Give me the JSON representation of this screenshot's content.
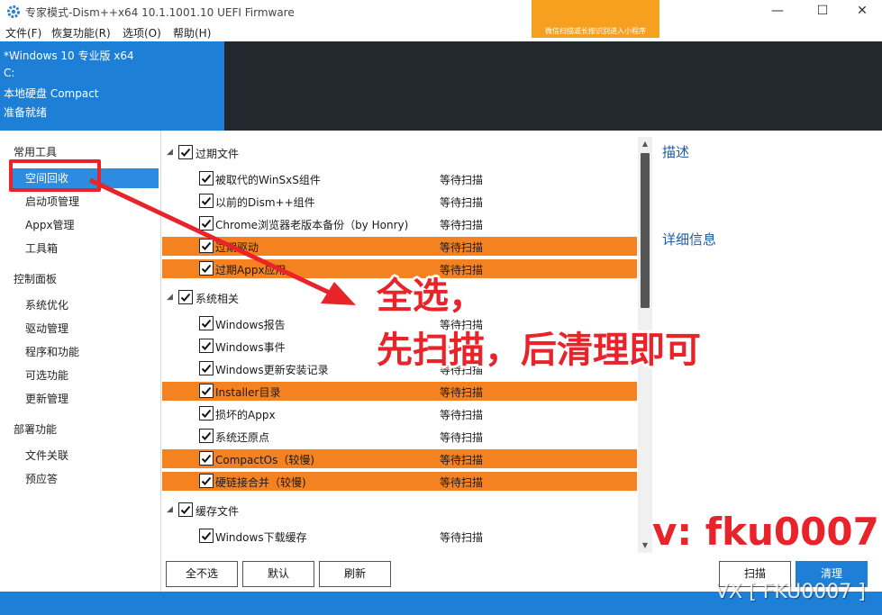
{
  "titlebar": {
    "title": "专家模式-Dism++x64 10.1.1001.10 UEFI Firmware",
    "min_glyph": "—",
    "max_glyph": "☐",
    "close_glyph": "✕"
  },
  "banner_ad": {
    "text": "微信扫描或长按识别进入小程序"
  },
  "menu": [
    {
      "label": "文件(F)"
    },
    {
      "label": "恢复功能(R)"
    },
    {
      "label": "选项(O)"
    },
    {
      "label": "帮助(H)"
    }
  ],
  "info": {
    "os": "*Windows 10 专业版 x64",
    "drive": "C:",
    "disk": "本地硬盘 Compact",
    "status": "准备就绪"
  },
  "sidebar": {
    "groups": [
      {
        "label": "常用工具",
        "items": [
          "空间回收",
          "启动项管理",
          "Appx管理",
          "工具箱"
        ]
      },
      {
        "label": "控制面板",
        "items": [
          "系统优化",
          "驱动管理",
          "程序和功能",
          "可选功能",
          "更新管理"
        ]
      },
      {
        "label": "部署功能",
        "items": [
          "文件关联",
          "预应答"
        ]
      }
    ],
    "active_item": "空间回收"
  },
  "list": {
    "categories": [
      {
        "label": "过期文件",
        "items": [
          {
            "label": "被取代的WinSxS组件",
            "status": "等待扫描",
            "highlight": false
          },
          {
            "label": "以前的Dism++组件",
            "status": "等待扫描",
            "highlight": false
          },
          {
            "label": "Chrome浏览器老版本备份（by Honry)",
            "status": "等待扫描",
            "highlight": false
          },
          {
            "label": "过期驱动",
            "status": "等待扫描",
            "highlight": true
          },
          {
            "label": "过期Appx应用",
            "status": "等待扫描",
            "highlight": true
          }
        ]
      },
      {
        "label": "系统相关",
        "items": [
          {
            "label": "Windows报告",
            "status": "等待扫描",
            "highlight": false
          },
          {
            "label": "Windows事件",
            "status": "等待扫描",
            "highlight": false
          },
          {
            "label": "Windows更新安装记录",
            "status": "等待扫描",
            "highlight": false
          },
          {
            "label": "Installer目录",
            "status": "等待扫描",
            "highlight": true
          },
          {
            "label": "损坏的Appx",
            "status": "等待扫描",
            "highlight": false
          },
          {
            "label": "系统还原点",
            "status": "等待扫描",
            "highlight": false
          },
          {
            "label": "CompactOs（较慢)",
            "status": "等待扫描",
            "highlight": true
          },
          {
            "label": "硬链接合并（较慢)",
            "status": "等待扫描",
            "highlight": true
          }
        ]
      },
      {
        "label": "缓存文件",
        "items": [
          {
            "label": "Windows下载缓存",
            "status": "等待扫描",
            "highlight": false
          }
        ]
      }
    ]
  },
  "details": {
    "description_title": "描述",
    "detail_title": "详细信息"
  },
  "buttons": {
    "select_none": "全不选",
    "default": "默认",
    "refresh": "刷新",
    "scan": "扫描",
    "clean": "清理"
  },
  "annotations": {
    "line1": "全选，",
    "line2": "先扫描，后清理即可",
    "contact": "v: fku0007",
    "watermark": "VX [ FKU0007 ]"
  },
  "colors": {
    "accent_blue": "#1e7fd6",
    "highlight_orange": "#f58220",
    "annotation_red": "#e8232a",
    "dark_panel": "#23272e"
  }
}
